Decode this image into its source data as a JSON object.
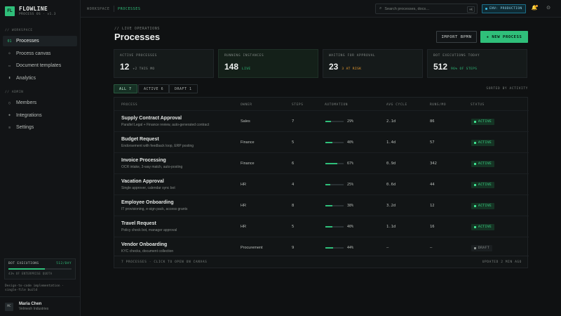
{
  "brand": {
    "logo": "FL",
    "name": "FLOWLINE",
    "sub": "PROCESS OS · v1.3"
  },
  "sidebar": {
    "workspace_label": "// WORKSPACE",
    "admin_label": "// ADMIN",
    "workspace_items": [
      {
        "label": "Processes",
        "icon": "process-icon",
        "glyph": "01",
        "active": true
      },
      {
        "label": "Process canvas",
        "icon": "canvas-icon",
        "glyph": "◇"
      },
      {
        "label": "Document templates",
        "icon": "document-icon",
        "glyph": "▭"
      },
      {
        "label": "Analytics",
        "icon": "analytics-icon",
        "glyph": "▮"
      }
    ],
    "admin_items": [
      {
        "label": "Members",
        "icon": "members-icon",
        "glyph": "◯"
      },
      {
        "label": "Integrations",
        "icon": "integrations-icon",
        "glyph": "◈"
      },
      {
        "label": "Settings",
        "icon": "settings-icon",
        "glyph": "≡"
      }
    ],
    "quota": {
      "label": "BOT EXECUTIONS",
      "value": "512/DAY",
      "fraction": 0.58,
      "sub": "43% OF ENTERPRISE QUOTA"
    },
    "note": "Design-to-code implementation · single-file build",
    "user": {
      "initials": "MC",
      "name": "Maria Chen",
      "org": "Velmesh Industries"
    }
  },
  "topbar": {
    "crumbs": [
      "WORKSPACE",
      "PROCESSES"
    ],
    "search_placeholder": "Search processes, docs…",
    "search_shortcut": "⌘K",
    "env": "ENV: PRODUCTION"
  },
  "header": {
    "eyebrow": "// LIVE OPERATIONS",
    "title": "Processes",
    "import_label": "IMPORT BPMN",
    "new_label": "+ NEW PROCESS"
  },
  "kpis": [
    {
      "label": "ACTIVE PROCESSES",
      "value": "12",
      "note": "+2 THIS MO",
      "note_color": "#8a908d"
    },
    {
      "label": "RUNNING INSTANCES",
      "value": "148",
      "note": "LIVE",
      "note_color": "#2fbf7a"
    },
    {
      "label": "WAITING FOR APPROVAL",
      "value": "23",
      "note": "3 AT RISK",
      "note_color": "#f0a030"
    },
    {
      "label": "BOT EXECUTIONS TODAY",
      "value": "512",
      "note": "96% OF STEPS",
      "note_color": "#2fbf7a"
    }
  ],
  "filters": [
    "ALL 7",
    "ACTIVE 6",
    "DRAFT 1"
  ],
  "sorted_label": "SORTED BY ACTIVITY",
  "table": {
    "headers": [
      "PROCESS",
      "OWNER",
      "STEPS",
      "AUTOMATION",
      "AVG CYCLE",
      "RUNS/MO",
      "STATUS"
    ],
    "rows": [
      {
        "name": "Supply Contract Approval",
        "desc": "Parallel Legal + Finance review, auto-generated contract",
        "owner": "Sales",
        "steps": "7",
        "automation": 29,
        "automation_label": "29%",
        "cycle": "2.1d",
        "runs": "86",
        "status": "ACTIVE"
      },
      {
        "name": "Budget Request",
        "desc": "Endorsement with feedback loop, ERP posting",
        "owner": "Finance",
        "steps": "5",
        "automation": 40,
        "automation_label": "40%",
        "cycle": "1.4d",
        "runs": "57",
        "status": "ACTIVE"
      },
      {
        "name": "Invoice Processing",
        "desc": "OCR intake, 3-way match, auto-posting",
        "owner": "Finance",
        "steps": "6",
        "automation": 67,
        "automation_label": "67%",
        "cycle": "0.9d",
        "runs": "342",
        "status": "ACTIVE"
      },
      {
        "name": "Vacation Approval",
        "desc": "Single approver, calendar sync bot",
        "owner": "HR",
        "steps": "4",
        "automation": 25,
        "automation_label": "25%",
        "cycle": "0.6d",
        "runs": "44",
        "status": "ACTIVE"
      },
      {
        "name": "Employee Onboarding",
        "desc": "IT provisioning, e-sign pack, access grants",
        "owner": "HR",
        "steps": "8",
        "automation": 38,
        "automation_label": "38%",
        "cycle": "3.2d",
        "runs": "12",
        "status": "ACTIVE"
      },
      {
        "name": "Travel Request",
        "desc": "Policy check bot, manager approval",
        "owner": "HR",
        "steps": "5",
        "automation": 40,
        "automation_label": "40%",
        "cycle": "1.1d",
        "runs": "16",
        "status": "ACTIVE"
      },
      {
        "name": "Vendor Onboarding",
        "desc": "KYC checks, document collection",
        "owner": "Procurement",
        "steps": "9",
        "automation": 44,
        "automation_label": "44%",
        "cycle": "—",
        "runs": "—",
        "status": "DRAFT"
      }
    ],
    "footer_left": "7 PROCESSES · CLICK TO OPEN ON CANVAS",
    "footer_right": "UPDATED 2 MIN AGO"
  }
}
